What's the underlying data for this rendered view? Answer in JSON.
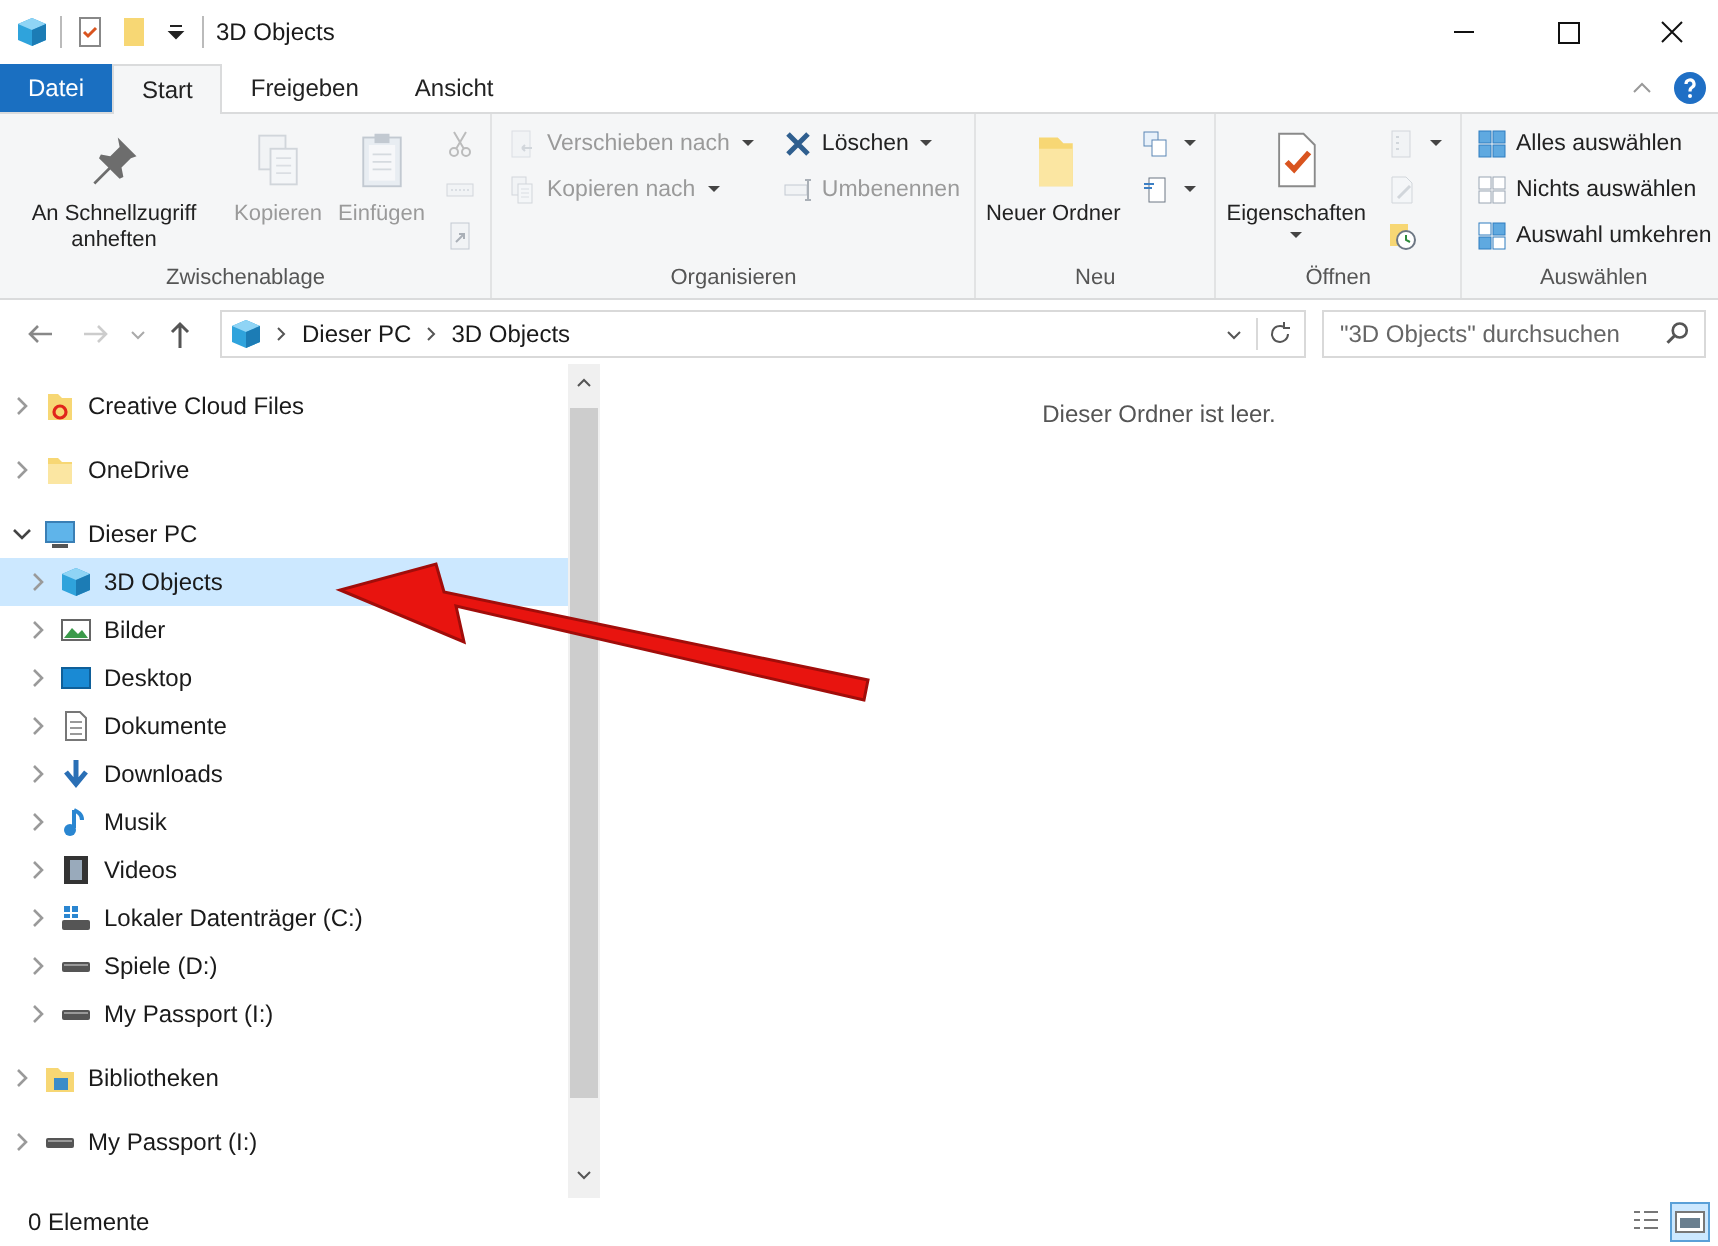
{
  "window": {
    "title": "3D Objects"
  },
  "tabs": [
    {
      "label": "Datei",
      "kind": "file",
      "selected": false
    },
    {
      "label": "Start",
      "kind": "tab",
      "selected": true
    },
    {
      "label": "Freigeben",
      "kind": "tab",
      "selected": false
    },
    {
      "label": "Ansicht",
      "kind": "tab",
      "selected": false
    }
  ],
  "ribbon": {
    "groups": [
      {
        "label": "Zwischenablage",
        "columns": [
          {
            "kind": "large",
            "items": [
              {
                "label": "An Schnellzugriff anheften",
                "disabled": false,
                "dropdown": false
              }
            ]
          },
          {
            "kind": "large",
            "items": [
              {
                "label": "Kopieren",
                "disabled": true,
                "dropdown": false
              }
            ]
          },
          {
            "kind": "large",
            "items": [
              {
                "label": "Einfügen",
                "disabled": true,
                "dropdown": false
              }
            ]
          },
          {
            "kind": "stack",
            "items": [
              {
                "disabled": true,
                "dropdown": false
              },
              {
                "disabled": true,
                "dropdown": false
              },
              {
                "disabled": true,
                "dropdown": false
              }
            ]
          }
        ]
      },
      {
        "label": "Organisieren",
        "columns": [
          {
            "kind": "stack",
            "items": [
              {
                "label": "Verschieben nach",
                "disabled": true,
                "dropdown": true
              },
              {
                "label": "Kopieren nach",
                "disabled": true,
                "dropdown": true
              }
            ]
          },
          {
            "kind": "stack",
            "items": [
              {
                "label": "Löschen",
                "disabled": false,
                "dropdown": true
              },
              {
                "label": "Umbenennen",
                "disabled": true,
                "dropdown": false
              }
            ]
          }
        ]
      },
      {
        "label": "Neu",
        "columns": [
          {
            "kind": "large",
            "items": [
              {
                "label": "Neuer Ordner",
                "disabled": false,
                "dropdown": false
              }
            ]
          },
          {
            "kind": "stack",
            "items": [
              {
                "disabled": false,
                "dropdown": true
              },
              {
                "disabled": false,
                "dropdown": true
              }
            ]
          }
        ]
      },
      {
        "label": "Öffnen",
        "columns": [
          {
            "kind": "large",
            "items": [
              {
                "label": "Eigenschaften",
                "disabled": false,
                "dropdown": true
              }
            ]
          },
          {
            "kind": "stack",
            "items": [
              {
                "disabled": true,
                "dropdown": true
              },
              {
                "disabled": true,
                "dropdown": false
              },
              {
                "disabled": false,
                "dropdown": false
              }
            ]
          }
        ]
      },
      {
        "label": "Auswählen",
        "columns": [
          {
            "kind": "stack",
            "items": [
              {
                "label": "Alles auswählen",
                "disabled": false,
                "dropdown": false
              },
              {
                "label": "Nichts auswählen",
                "disabled": false,
                "dropdown": false
              },
              {
                "label": "Auswahl umkehren",
                "disabled": false,
                "dropdown": false
              }
            ]
          }
        ]
      }
    ]
  },
  "address_bar": {
    "breadcrumb": [
      "Dieser PC",
      "3D Objects"
    ]
  },
  "search": {
    "placeholder": "\"3D Objects\" durchsuchen"
  },
  "navigation_pane": {
    "items": [
      {
        "label": "Creative Cloud Files",
        "expanded": false,
        "selected": false
      },
      {
        "label": "OneDrive",
        "expanded": false,
        "selected": false
      },
      {
        "label": "Dieser PC",
        "expanded": true,
        "selected": false,
        "children": [
          {
            "label": "3D Objects",
            "expanded": false,
            "selected": true
          },
          {
            "label": "Bilder",
            "expanded": false,
            "selected": false
          },
          {
            "label": "Desktop",
            "expanded": false,
            "selected": false
          },
          {
            "label": "Dokumente",
            "expanded": false,
            "selected": false
          },
          {
            "label": "Downloads",
            "expanded": false,
            "selected": false
          },
          {
            "label": "Musik",
            "expanded": false,
            "selected": false
          },
          {
            "label": "Videos",
            "expanded": false,
            "selected": false
          },
          {
            "label": "Lokaler Datenträger (C:)",
            "expanded": false,
            "selected": false
          },
          {
            "label": "Spiele (D:)",
            "expanded": false,
            "selected": false
          },
          {
            "label": "My Passport (I:)",
            "expanded": false,
            "selected": false
          }
        ]
      },
      {
        "label": "Bibliotheken",
        "expanded": false,
        "selected": false
      },
      {
        "label": "My Passport (I:)",
        "expanded": false,
        "selected": false
      }
    ]
  },
  "content": {
    "empty_message": "Dieser Ordner ist leer."
  },
  "status_bar": {
    "item_count": "0 Elemente",
    "views": [
      {
        "selected": false
      },
      {
        "selected": true
      }
    ]
  }
}
